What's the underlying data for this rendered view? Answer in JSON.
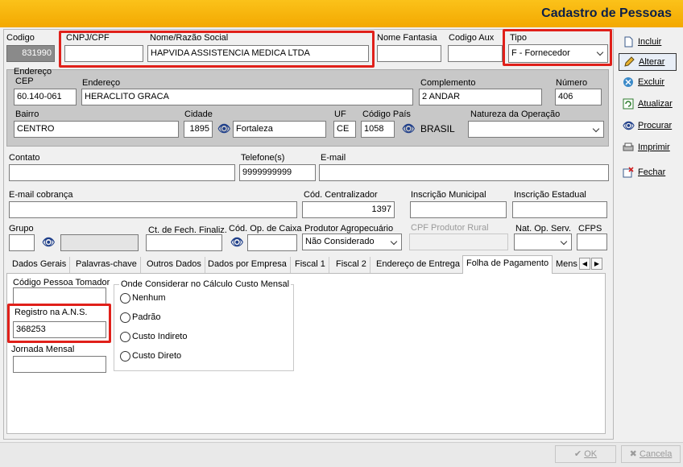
{
  "window": {
    "title": "Cadastro de Pessoas"
  },
  "toolbar": {
    "incluir": "Incluir",
    "alterar": "Alterar",
    "excluir": "Excluir",
    "atualizar": "Atualizar",
    "procurar": "Procurar",
    "imprimir": "Imprimir",
    "fechar": "Fechar"
  },
  "form": {
    "codigo_label": "Codigo",
    "codigo_value": "831990",
    "cnpj_label": "CNPJ/CPF",
    "cnpj_value": "",
    "nome_label": "Nome/Razão Social",
    "nome_value": "HAPVIDA ASSISTENCIA MEDICA LTDA",
    "fantasia_label": "Nome Fantasia",
    "fantasia_value": "",
    "codaux_label": "Codigo Aux",
    "codaux_value": "",
    "tipo_label": "Tipo",
    "tipo_value": "F - Fornecedor"
  },
  "endereco": {
    "group_label": "Endereço",
    "cep_label": "CEP",
    "cep_value": "60.140-061",
    "endereco_label": "Endereço",
    "endereco_value": "HERACLITO GRACA",
    "complemento_label": "Complemento",
    "complemento_value": "2 ANDAR",
    "numero_label": "Número",
    "numero_value": "406",
    "bairro_label": "Bairro",
    "bairro_value": "CENTRO",
    "cidade_label": "Cidade",
    "cidade_code": "1895",
    "cidade_name": "Fortaleza",
    "uf_label": "UF",
    "uf_value": "CE",
    "codpais_label": "Código País",
    "codpais_value": "1058",
    "pais_name": "BRASIL",
    "natureza_label": "Natureza da Operação",
    "natureza_value": ""
  },
  "contato": {
    "contato_label": "Contato",
    "contato_value": "",
    "telefone_label": "Telefone(s)",
    "telefone_value": "9999999999",
    "email_label": "E-mail",
    "email_value": "",
    "emailcob_label": "E-mail cobrança",
    "emailcob_value": "",
    "centralizador_label": "Cód. Centralizador",
    "centralizador_value": "1397",
    "inscmun_label": "Inscrição Municipal",
    "inscmun_value": "",
    "inscest_label": "Inscrição Estadual",
    "inscest_value": "",
    "grupo_label": "Grupo",
    "grupo_value": "",
    "ctfech_label": "Ct. de Fech. Finaliz.",
    "ctfech_value": "",
    "codop_label": "Cód. Op. de Caixa",
    "codop_value": "",
    "produtor_label": "Produtor Agropecuário",
    "produtor_value": "Não Considerado",
    "cpfprod_label": "CPF Produtor Rural",
    "cpfprod_value": "",
    "natop_label": "Nat. Op. Serv.",
    "natop_value": "",
    "cfps_label": "CFPS",
    "cfps_value": ""
  },
  "tabs": [
    "Dados Gerais",
    "Palavras-chave",
    "Outros Dados",
    "Dados por Empresa",
    "Fiscal 1",
    "Fiscal 2",
    "Endereço de Entrega",
    "Folha de Pagamento",
    "Mens"
  ],
  "folha": {
    "cod_tomador_label": "Código Pessoa Tomador",
    "cod_tomador_value": "",
    "ans_label": "Registro na A.N.S.",
    "ans_value": "368253",
    "jornada_label": "Jornada Mensal",
    "jornada_value": "",
    "custo_group_label": "Onde Considerar no Cálculo Custo Mensal",
    "options": [
      "Nenhum",
      "Padrão",
      "Custo Indireto",
      "Custo Direto"
    ]
  },
  "footer": {
    "ok": "OK",
    "cancela": "Cancela"
  },
  "colors": {
    "title_bar": "#f7b500",
    "highlight": "#e0201a",
    "group_bg": "#c8c8c8"
  }
}
